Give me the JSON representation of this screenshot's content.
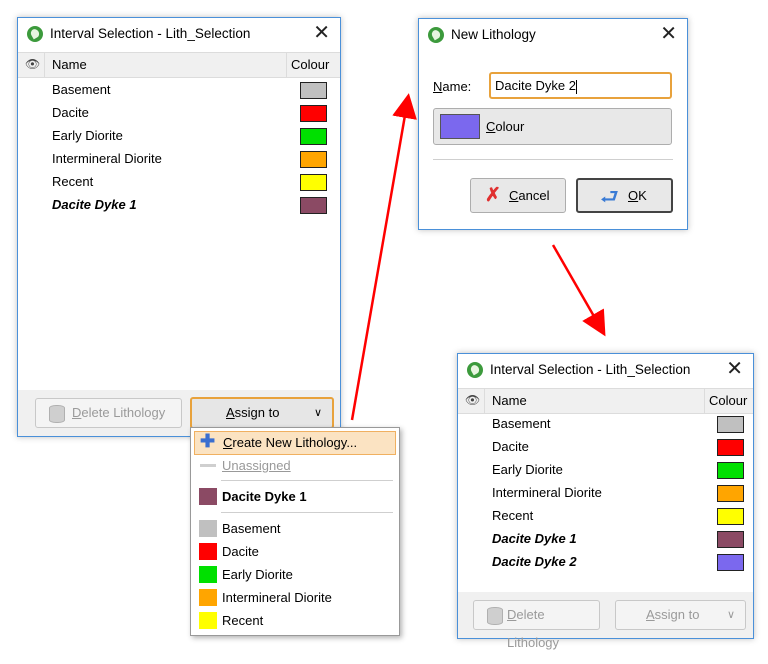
{
  "dialog1": {
    "title": "Interval Selection - Lith_Selection",
    "columns": {
      "name": "Name",
      "colour": "Colour"
    },
    "rows": [
      {
        "name": "Basement",
        "color": "#c0c0c0",
        "bold": false
      },
      {
        "name": "Dacite",
        "color": "#ff0000",
        "bold": false
      },
      {
        "name": "Early Diorite",
        "color": "#00e000",
        "bold": false
      },
      {
        "name": "Intermineral Diorite",
        "color": "#ffa500",
        "bold": false
      },
      {
        "name": "Recent",
        "color": "#ffff00",
        "bold": false
      },
      {
        "name": "Dacite Dyke 1",
        "color": "#8b4a64",
        "bold": true
      }
    ],
    "delete_label_u": "D",
    "delete_label_rest": "elete Lithology",
    "assign_label_u": "A",
    "assign_label_rest": "ssign to"
  },
  "menu": {
    "create_u": "C",
    "create_rest": "reate New Lithology...",
    "unassigned": "Unassigned",
    "highlight_item": {
      "name": "Dacite Dyke 1",
      "color": "#8b4a64"
    },
    "items": [
      {
        "name": "Basement",
        "color": "#c0c0c0"
      },
      {
        "name": "Dacite",
        "color": "#ff0000"
      },
      {
        "name": "Early Diorite",
        "color": "#00e000"
      },
      {
        "name": "Intermineral Diorite",
        "color": "#ffa500"
      },
      {
        "name": "Recent",
        "color": "#ffff00"
      }
    ]
  },
  "dialog2": {
    "title": "New Lithology",
    "name_label_u": "N",
    "name_label_rest": "ame:",
    "name_value": "Dacite Dyke 2",
    "colour_label_u": "C",
    "colour_label_rest": "olour",
    "colour_swatch": "#7b68ee",
    "cancel_u": "C",
    "cancel_rest": "ancel",
    "ok_u": "O",
    "ok_rest": "K"
  },
  "dialog3": {
    "title": "Interval Selection - Lith_Selection",
    "columns": {
      "name": "Name",
      "colour": "Colour"
    },
    "rows": [
      {
        "name": "Basement",
        "color": "#c0c0c0",
        "bold": false
      },
      {
        "name": "Dacite",
        "color": "#ff0000",
        "bold": false
      },
      {
        "name": "Early Diorite",
        "color": "#00e000",
        "bold": false
      },
      {
        "name": "Intermineral Diorite",
        "color": "#ffa500",
        "bold": false
      },
      {
        "name": "Recent",
        "color": "#ffff00",
        "bold": false
      },
      {
        "name": "Dacite Dyke 1",
        "color": "#8b4a64",
        "bold": true
      },
      {
        "name": "Dacite Dyke 2",
        "color": "#7b68ee",
        "bold": true
      }
    ],
    "delete_label_u": "D",
    "delete_label_rest": "elete Lithology",
    "assign_label_u": "A",
    "assign_label_rest": "ssign to"
  },
  "arrow_color": "#ff0000"
}
